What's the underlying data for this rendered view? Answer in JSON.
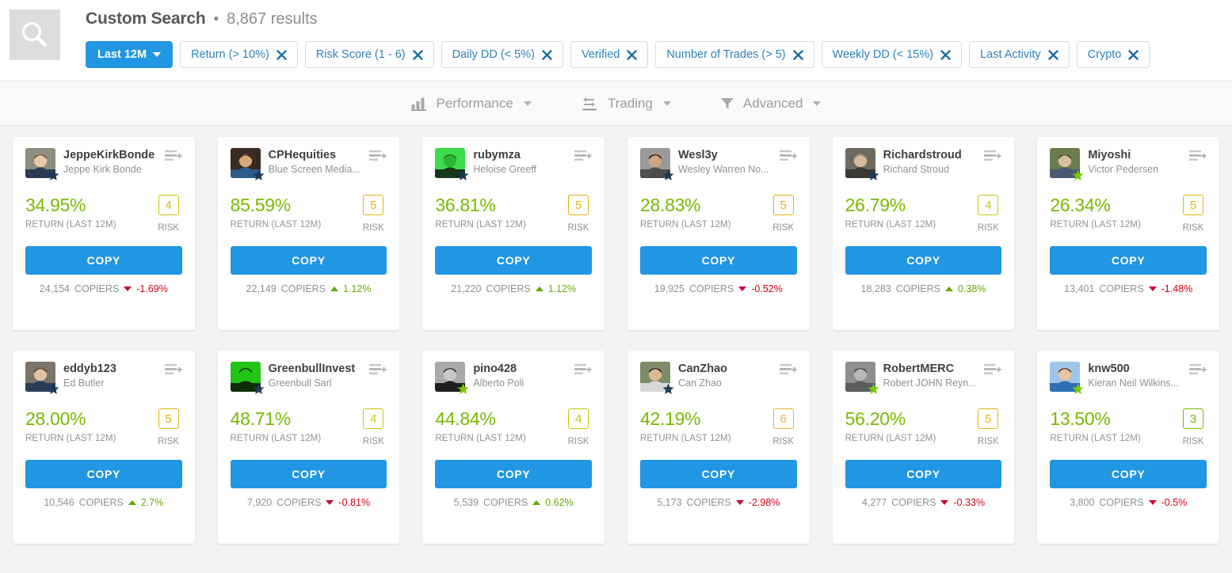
{
  "header": {
    "search_icon": "search-icon",
    "title": "Custom Search",
    "separator": "•",
    "results_text": "8,867 results",
    "chips": [
      {
        "label": "Last 12M",
        "type": "dropdown",
        "icon": "chevron-down-icon"
      },
      {
        "label": "Return (> 10%)",
        "type": "removable",
        "icon": "close-icon"
      },
      {
        "label": "Risk Score (1 - 6)",
        "type": "removable",
        "icon": "close-icon"
      },
      {
        "label": "Daily DD (< 5%)",
        "type": "removable",
        "icon": "close-icon"
      },
      {
        "label": "Verified",
        "type": "removable",
        "icon": "close-icon"
      },
      {
        "label": "Number of Trades (> 5)",
        "type": "removable",
        "icon": "close-icon"
      },
      {
        "label": "Weekly DD (< 15%)",
        "type": "removable",
        "icon": "close-icon"
      },
      {
        "label": "Last Activity",
        "type": "removable",
        "icon": "close-icon"
      },
      {
        "label": "Crypto",
        "type": "removable",
        "icon": "close-icon"
      }
    ]
  },
  "toolbar": {
    "items": [
      {
        "label": "Performance",
        "icon": "bar-chart-icon"
      },
      {
        "label": "Trading",
        "icon": "exchange-arrows-icon"
      },
      {
        "label": "Advanced",
        "icon": "filter-funnel-icon"
      }
    ]
  },
  "labels": {
    "return_label": "RETURN (LAST 12M)",
    "risk_label": "RISK",
    "copy_label": "COPY",
    "copiers_suffix": "COPIERS",
    "add_to_list_icon": "add-to-list-icon",
    "verified_star_icon": "verified-star-icon"
  },
  "colors": {
    "accent_blue": "#2196e3",
    "return_green": "#7ab800",
    "positive": "#6aa80c",
    "negative": "#d0021b",
    "risk_3": "#7ab800",
    "risk_4": "#c9c60a",
    "risk_5": "#e0b410",
    "risk_6": "#e8b43a",
    "star_blue": "#1b3a57",
    "star_green": "#7ac70c"
  },
  "cards": [
    {
      "username": "JeppeKirkBonde",
      "fullname": "Jeppe Kirk Bonde",
      "return": "34.95%",
      "risk": "4",
      "risk_color": "#c9c60a",
      "copiers": "24,154",
      "delta": "-1.69%",
      "direction": "down",
      "star_color": "#1b3a57",
      "avatar": {
        "bg": "#8a8f7e",
        "skin": "#e8c9a8",
        "hair": "#6b5237",
        "shirt": "#2b3d55"
      }
    },
    {
      "username": "CPHequities",
      "fullname": "Blue Screen Media...",
      "return": "85.59%",
      "risk": "5",
      "risk_color": "#e0b410",
      "copiers": "22,149",
      "delta": "1.12%",
      "direction": "up",
      "star_color": "#1b3a57",
      "avatar": {
        "bg": "#3a2a20",
        "skin": "#d9a877",
        "hair": "#3a2318",
        "shirt": "#2c5b8c"
      }
    },
    {
      "username": "rubymza",
      "fullname": "Heloise Greeff",
      "return": "36.81%",
      "risk": "5",
      "risk_color": "#e0b410",
      "copiers": "21,220",
      "delta": "1.12%",
      "direction": "up",
      "star_color": "#1b3a57",
      "avatar": {
        "bg": "#3ddc4a",
        "skin": "#2eb33c",
        "hair": "#1c7a26",
        "shirt": "#17361c"
      }
    },
    {
      "username": "Wesl3y",
      "fullname": "Wesley Warren No...",
      "return": "28.83%",
      "risk": "5",
      "risk_color": "#e0b410",
      "copiers": "19,925",
      "delta": "-0.52%",
      "direction": "down",
      "star_color": "#1b3a57",
      "avatar": {
        "bg": "#9a9a9a",
        "skin": "#cfa583",
        "hair": "#241a14",
        "shirt": "#4c4c4c"
      }
    },
    {
      "username": "Richardstroud",
      "fullname": "Richard Stroud",
      "return": "26.79%",
      "risk": "4",
      "risk_color": "#c9c60a",
      "copiers": "18,283",
      "delta": "0.38%",
      "direction": "up",
      "star_color": "#1b3a57",
      "avatar": {
        "bg": "#6f6a5f",
        "skin": "#ddb894",
        "hair": "#8d8174",
        "shirt": "#3c3a35"
      }
    },
    {
      "username": "Miyoshi",
      "fullname": "Victor Pedersen",
      "return": "26.34%",
      "risk": "5",
      "risk_color": "#e0b410",
      "copiers": "13,401",
      "delta": "-1.48%",
      "direction": "down",
      "star_color": "#7ac70c",
      "avatar": {
        "bg": "#6b7c4a",
        "skin": "#d8bf9a",
        "hair": "#3f3a2c",
        "shirt": "#4a5a74"
      }
    },
    {
      "username": "eddyb123",
      "fullname": "Ed Butler",
      "return": "28.00%",
      "risk": "5",
      "risk_color": "#e0b410",
      "copiers": "10,546",
      "delta": "2.7%",
      "direction": "up",
      "star_color": "#1b3a57",
      "avatar": {
        "bg": "#7c7468",
        "skin": "#e3c2a2",
        "hair": "#4b3a2a",
        "shirt": "#2a3c57"
      }
    },
    {
      "username": "GreenbullInvest",
      "fullname": "Greenbull Sarl",
      "return": "48.71%",
      "risk": "4",
      "risk_color": "#c9c60a",
      "copiers": "7,920",
      "delta": "-0.81%",
      "direction": "down",
      "star_color": "#1b3a57",
      "avatar": {
        "bg": "#22c416",
        "skin": "#22c416",
        "hair": "#0d2c08",
        "shirt": "#0d2c08"
      }
    },
    {
      "username": "pino428",
      "fullname": "Alberto Poli",
      "return": "44.84%",
      "risk": "4",
      "risk_color": "#c9c60a",
      "copiers": "5,539",
      "delta": "0.62%",
      "direction": "up",
      "star_color": "#7ac70c",
      "avatar": {
        "bg": "#a9a9a9",
        "skin": "#c9c9c9",
        "hair": "#2a2a2a",
        "shirt": "#1f1f1f"
      }
    },
    {
      "username": "CanZhao",
      "fullname": "Can Zhao",
      "return": "42.19%",
      "risk": "6",
      "risk_color": "#e8b43a",
      "copiers": "5,173",
      "delta": "-2.98%",
      "direction": "down",
      "star_color": "#1b3a57",
      "avatar": {
        "bg": "#7d8b6a",
        "skin": "#dcb894",
        "hair": "#221a12",
        "shirt": "#d8d8d8"
      }
    },
    {
      "username": "RobertMERC",
      "fullname": "Robert JOHN Reyn...",
      "return": "56.20%",
      "risk": "5",
      "risk_color": "#e0b410",
      "copiers": "4,277",
      "delta": "-0.33%",
      "direction": "down",
      "star_color": "#7ac70c",
      "avatar": {
        "bg": "#8e8e8e",
        "skin": "#b9b9b9",
        "hair": "#3b3b3b",
        "shirt": "#5c5c5c"
      }
    },
    {
      "username": "knw500",
      "fullname": "Kieran Neil Wilkins...",
      "return": "13.50%",
      "risk": "3",
      "risk_color": "#7ab800",
      "copiers": "3,800",
      "delta": "-0.5%",
      "direction": "down",
      "star_color": "#7ac70c",
      "avatar": {
        "bg": "#9ec6e8",
        "skin": "#e8c3a0",
        "hair": "#4a3526",
        "shirt": "#2f6fb5"
      }
    }
  ]
}
